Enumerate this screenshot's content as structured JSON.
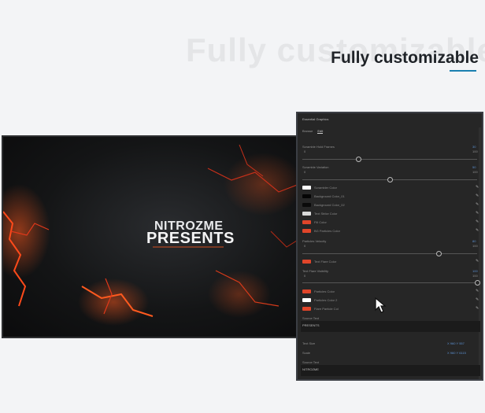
{
  "page": {
    "ghost_title": "Fully customizable",
    "headline": "Fully customizable"
  },
  "preview": {
    "brand_top": "NITROZME",
    "brand_main": "PRESENTS"
  },
  "panel": {
    "title": "Essential Graphics",
    "tabs": [
      "Browse",
      "Edit"
    ],
    "active_tab": 1,
    "sliders": [
      {
        "label": "Scramble Hold Frames",
        "min": "0",
        "max": "100",
        "value_text": "30",
        "fraction": 0.32
      },
      {
        "label": "Scramble Variation",
        "min": "0",
        "max": "100",
        "value_text": "50",
        "fraction": 0.5
      },
      {
        "label": "Particles Velocity",
        "min": "0",
        "max": "100",
        "value_text": "80",
        "fraction": 0.78
      },
      {
        "label": "Text Flare Visibility",
        "min": "0",
        "max": "100",
        "value_text": "100",
        "fraction": 1.0
      }
    ],
    "swatches_a": [
      {
        "label": "Scrambler Color",
        "color": "#ffffff"
      },
      {
        "label": "Background Color_01",
        "color": "#050505"
      },
      {
        "label": "Background Color_02",
        "color": "#0a0a0a"
      },
      {
        "label": "Text Strike Color",
        "color": "#d9d9d9"
      },
      {
        "label": "Fill Color",
        "color": "#e0452a"
      },
      {
        "label": "BG Particles Color",
        "color": "#e0452a"
      }
    ],
    "swatches_b": [
      {
        "label": "Text Flare Color",
        "color": "#e0452a"
      }
    ],
    "swatches_c": [
      {
        "label": "Particles Color",
        "color": "#e0452a"
      },
      {
        "label": "Particles Color 2",
        "color": "#ffffff"
      },
      {
        "label": "Flare Particle Col",
        "color": "#e0452a"
      }
    ],
    "source_text_label": "Source Text",
    "source_text_value": "PRESENTS",
    "text_size_label": "Text Size",
    "text_size_values": "X 960   Y 557",
    "scale_label": "Scale",
    "scale_values": "X 960   Y 6115",
    "source_text2_label": "Source Text",
    "source_text2_value": "NITROZME"
  }
}
